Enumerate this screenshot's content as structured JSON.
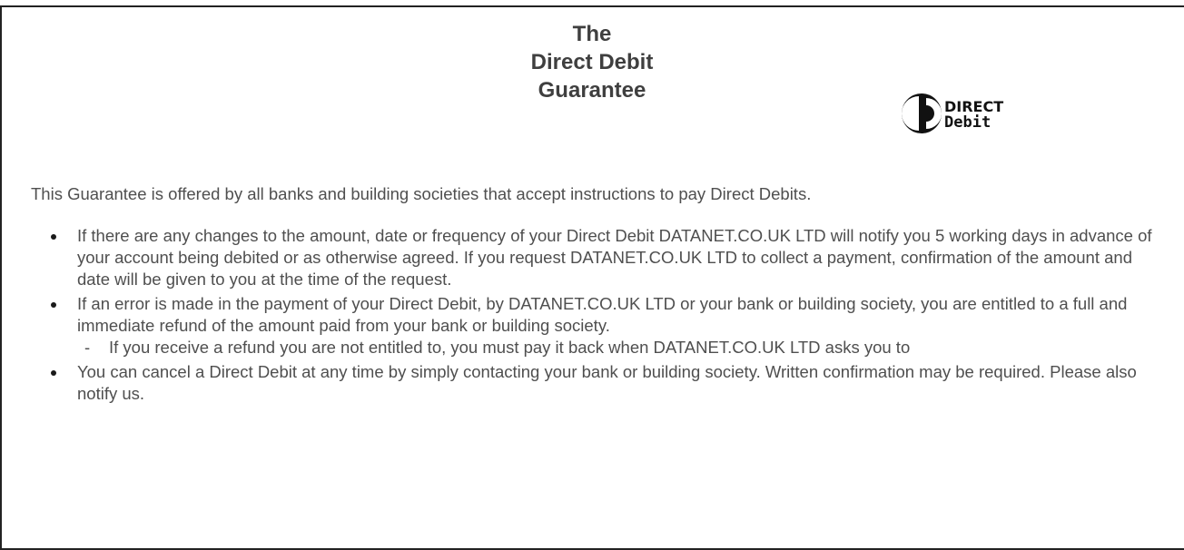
{
  "heading": {
    "line1": "The",
    "line2": "Direct Debit",
    "line3": "Guarantee"
  },
  "logo": {
    "text_top": "DIRECT",
    "text_bottom": "Debit",
    "color": "#111111"
  },
  "intro": "This Guarantee is offered by all banks and building societies that accept instructions to pay Direct Debits.",
  "items": [
    {
      "text": "If there are any changes to the amount, date or frequency of your Direct Debit  DATANET.CO.UK LTD will notify you 5 working days in advance of your account being debited or as otherwise agreed.  If you request DATANET.CO.UK LTD to collect a payment, confirmation of the amount and date will be given to you at the time of the request."
    },
    {
      "text": "If an error is made in the payment of your Direct Debit, by DATANET.CO.UK LTD or your bank or building society, you are entitled to a full and immediate refund of the amount paid from your bank or building society.",
      "sub": "If you receive a refund you are not entitled to, you must pay it back when DATANET.CO.UK LTD asks you to"
    },
    {
      "text": "You can cancel a Direct Debit at any time by simply contacting your bank or building society. Written confirmation may be required.  Please also notify us."
    }
  ],
  "sub_marker": "-"
}
